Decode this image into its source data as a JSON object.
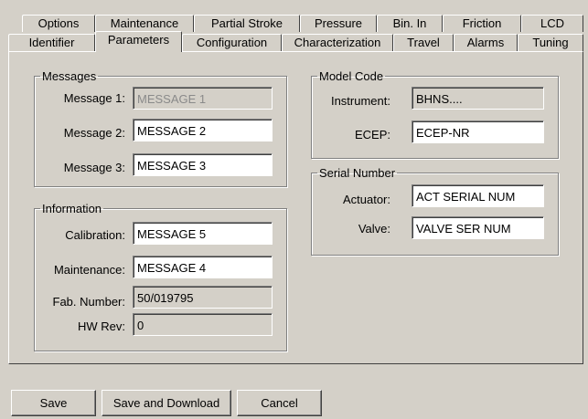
{
  "tabs": {
    "row_back": [
      {
        "label": "Options"
      },
      {
        "label": "Maintenance"
      },
      {
        "label": "Partial Stroke"
      },
      {
        "label": "Pressure"
      },
      {
        "label": "Bin. In"
      },
      {
        "label": "Friction"
      },
      {
        "label": "LCD"
      }
    ],
    "row_front": [
      {
        "label": "Identifier"
      },
      {
        "label": "Parameters"
      },
      {
        "label": "Configuration"
      },
      {
        "label": "Characterization"
      },
      {
        "label": "Travel"
      },
      {
        "label": "Alarms"
      },
      {
        "label": "Tuning"
      }
    ],
    "active": "Parameters"
  },
  "messages": {
    "title": "Messages",
    "m1_label": "Message 1:",
    "m1_value": "MESSAGE 1",
    "m2_label": "Message 2:",
    "m2_value": "MESSAGE 2",
    "m3_label": "Message 3:",
    "m3_value": "MESSAGE 3"
  },
  "information": {
    "title": "Information",
    "calibration_label": "Calibration:",
    "calibration_value": "MESSAGE 5",
    "maintenance_label": "Maintenance:",
    "maintenance_value": "MESSAGE 4",
    "fab_label": "Fab. Number:",
    "fab_value": "50/019795",
    "hw_label": "HW Rev:",
    "hw_value": "0"
  },
  "model_code": {
    "title": "Model Code",
    "instrument_label": "Instrument:",
    "instrument_value": "BHNS....",
    "ecep_label": "ECEP:",
    "ecep_value": "ECEP-NR"
  },
  "serial_number": {
    "title": "Serial Number",
    "actuator_label": "Actuator:",
    "actuator_value": "ACT SERIAL NUM",
    "valve_label": "Valve:",
    "valve_value": "VALVE SER NUM"
  },
  "buttons": {
    "save": "Save",
    "save_download": "Save and Download",
    "cancel": "Cancel"
  }
}
